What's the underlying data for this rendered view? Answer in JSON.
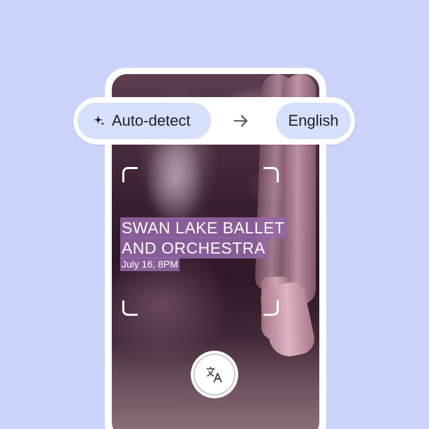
{
  "language_bar": {
    "source_label": "Auto-detect",
    "target_label": "English",
    "source_icon": "sparkle-icon",
    "swap_icon": "arrow-right-icon"
  },
  "recognized_text": {
    "line1": "SWAN LAKE BALLET",
    "line2": "AND ORCHESTRA",
    "line3": "July 16, 8PM"
  },
  "translate_button": {
    "icon": "translate-icon"
  },
  "colors": {
    "background": "#ccd3fa",
    "chip": "#d6e0fb",
    "text_highlight": "#9669aa",
    "frame": "#ffffff"
  }
}
